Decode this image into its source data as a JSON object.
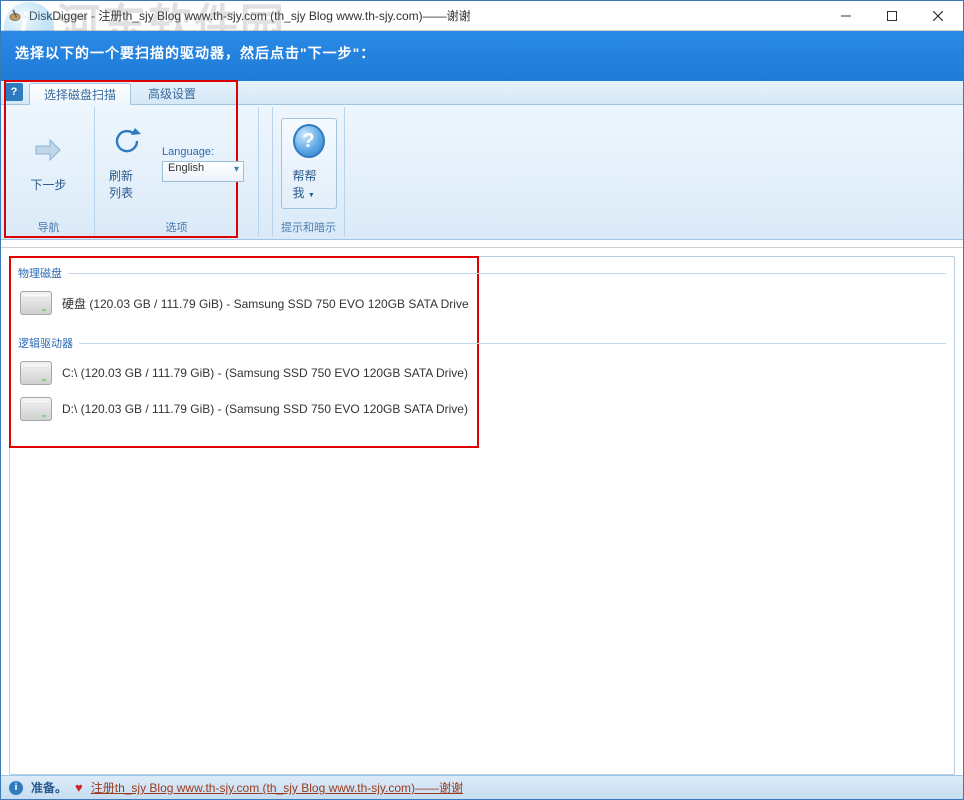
{
  "window": {
    "title": "DiskDigger - 注册th_sjy Blog www.th-sjy.com (th_sjy Blog www.th-sjy.com)——谢谢"
  },
  "instruction": "选择以下的一个要扫描的驱动器，然后点击\"下一步\"：",
  "watermark_text": "河东软件园",
  "tabs": {
    "scan": "选择磁盘扫描",
    "advanced": "高级设置"
  },
  "ribbon": {
    "nav": {
      "next": "下一步",
      "group_label": "导航"
    },
    "options": {
      "refresh": "刷新列表",
      "language_label": "Language:",
      "language_value": "English",
      "group_label": "选项"
    },
    "help": {
      "help_me": "帮帮我",
      "group_label": "提示和暗示"
    }
  },
  "drives": {
    "physical_header": "物理磁盘",
    "logical_header": "逻辑驱动器",
    "physical": [
      {
        "text": "硬盘 (120.03 GB / 111.79 GiB) - Samsung SSD 750 EVO 120GB SATA Drive"
      }
    ],
    "logical": [
      {
        "text": "C:\\ (120.03 GB / 111.79 GiB) -  (Samsung SSD 750 EVO 120GB SATA Drive)"
      },
      {
        "text": "D:\\ (120.03 GB / 111.79 GiB) -  (Samsung SSD 750 EVO 120GB SATA Drive)"
      }
    ]
  },
  "status": {
    "ready": "准备。",
    "link": "注册th_sjy Blog www.th-sjy.com (th_sjy Blog www.th-sjy.com)——谢谢"
  }
}
